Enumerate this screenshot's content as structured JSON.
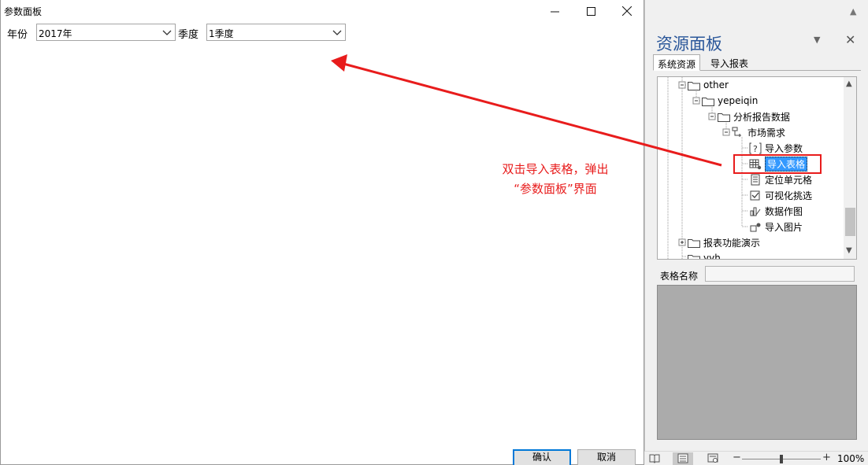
{
  "dialog": {
    "title": "参数面板",
    "fields": [
      {
        "label": "年份",
        "value": "2017年"
      },
      {
        "label": "季度",
        "value": "1季度"
      }
    ],
    "ok_label": "确认",
    "cancel_label": "取消"
  },
  "annotation": {
    "line1": "双击导入表格，弹出",
    "line2": "“参数面板”界面",
    "color": "#e81c1c"
  },
  "panel": {
    "title": "资源面板",
    "tabs": [
      "系统资源",
      "导入报表"
    ],
    "tree": [
      {
        "label": "other",
        "icon": "folder-icon",
        "expander": "minus"
      },
      {
        "label": "yepeiqin",
        "icon": "folder-icon",
        "expander": "minus"
      },
      {
        "label": "分析报告数据",
        "icon": "folder-icon",
        "expander": "minus"
      },
      {
        "label": "市场需求",
        "icon": "report-node-icon",
        "expander": "minus"
      },
      {
        "label": "导入参数",
        "icon": "param-icon"
      },
      {
        "label": "导入表格",
        "icon": "table-icon",
        "selected": true
      },
      {
        "label": "定位单元格",
        "icon": "cell-icon"
      },
      {
        "label": "可视化挑选",
        "icon": "visual-pick-icon"
      },
      {
        "label": "数据作图",
        "icon": "chart-icon"
      },
      {
        "label": "导入图片",
        "icon": "image-icon"
      },
      {
        "label": "报表功能演示",
        "icon": "folder-icon",
        "expander": "plus"
      },
      {
        "label": "yyh",
        "icon": "folder-icon",
        "expander": "plus"
      }
    ],
    "table_name_label": "表格名称",
    "table_name_value": "",
    "accent_color": "#2b579a",
    "selection_color": "#3399ff"
  },
  "statusbar": {
    "zoom_level": "100%",
    "zoom_fraction": 0.5
  }
}
